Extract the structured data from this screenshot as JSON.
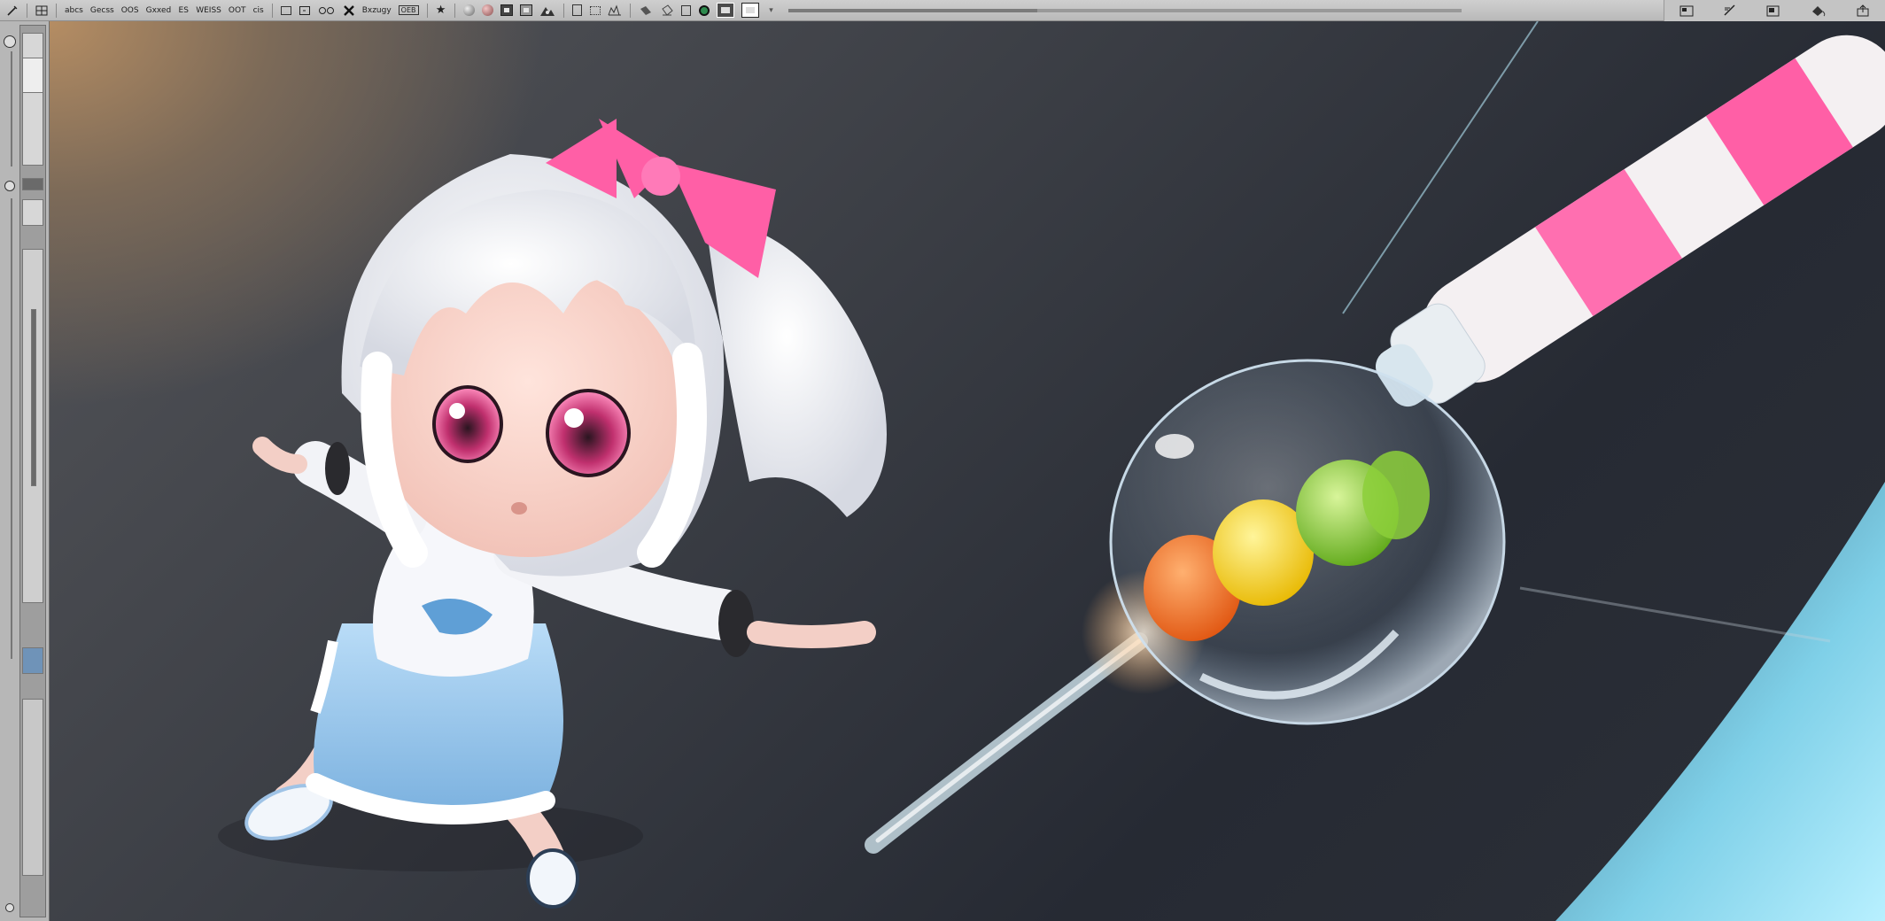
{
  "toolbar": {
    "items": [
      "abcs",
      "Gecss",
      "OOS",
      "Gxxed",
      "ES",
      "WEISS",
      "OOT",
      "cis",
      "Bxzugy",
      "OEB"
    ],
    "menu_chevron": "▾",
    "progress": 0.37
  },
  "icons": {
    "left_tools": [
      "pencil-icon",
      "grid-icon",
      "settings-icon",
      "eye-icon"
    ],
    "right_tools": [
      "panel-icon",
      "brush-icon",
      "layers-icon",
      "paint-bucket-icon",
      "export-icon"
    ]
  },
  "colors": {
    "toolbar_bg": "#c4c4c4",
    "panel_bg": "#b7b7b7",
    "canvas_dark": "#2b2e34",
    "accent_pink": "#ff5fa6",
    "skirt_blue": "#9ec8ec"
  }
}
